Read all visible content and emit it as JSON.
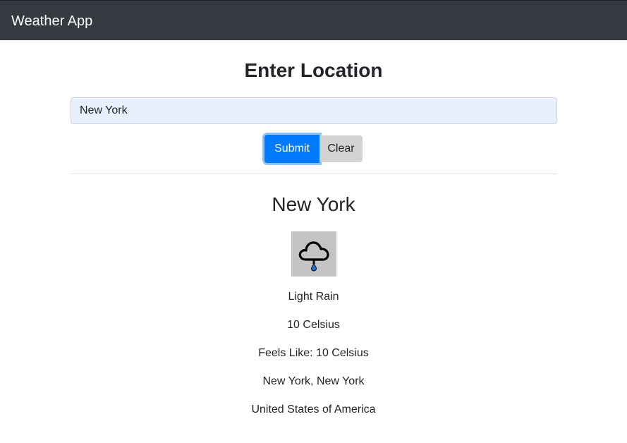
{
  "navbar": {
    "brand": "Weather App"
  },
  "form": {
    "title": "Enter Location",
    "location_value": "New York",
    "submit_label": "Submit",
    "clear_label": "Clear"
  },
  "weather": {
    "city": "New York",
    "icon": "rain-cloud-icon",
    "condition": "Light Rain",
    "temperature": "10 Celsius",
    "feels_like": "Feels Like: 10 Celsius",
    "region": "New York, New York",
    "country": "United States of America"
  },
  "colors": {
    "navbar_bg": "#343a40",
    "primary": "#007bff",
    "clear_button_bg": "#d3d3d3",
    "input_bg": "#e8f0fe",
    "icon_bg": "#c4c4c4",
    "raindrop": "#1f6fd1"
  }
}
